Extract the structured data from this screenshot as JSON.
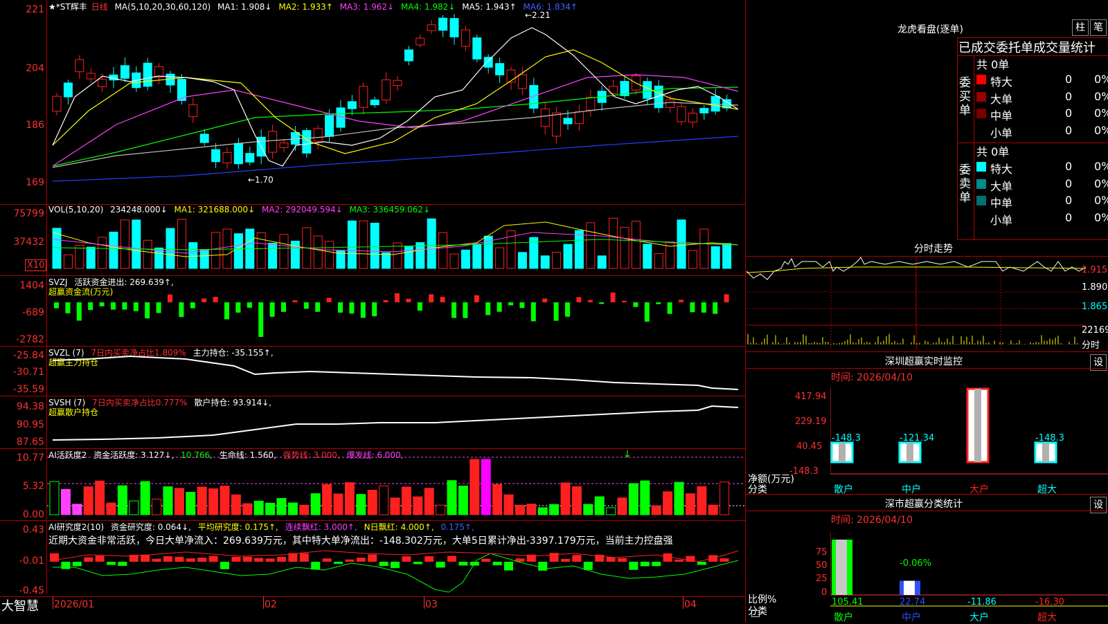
{
  "main": {
    "title_prefix": "★*ST辉丰",
    "period": "日线",
    "ma_label": "MA(5,10,20,30,60,120)",
    "ma1": "MA1: 1.908↓",
    "ma2": "MA2: 1.933↑",
    "ma3": "MA3: 1.962↓",
    "ma4": "MA4: 1.982↓",
    "ma5": "MA5: 1.943↑",
    "ma6": "MA6: 1.834↑",
    "high_mark": "2.21",
    "low_mark": "1.70",
    "y_ticks": [
      "221",
      "204",
      "186",
      "169"
    ]
  },
  "vol": {
    "label": "VOL(5,10,20)",
    "value": "234248.000↓",
    "ma1": "MA1: 321688.000↓",
    "ma2": "MA2: 292049.594↓",
    "ma3": "MA3: 336459.062↓",
    "y_ticks": [
      "75799",
      "37432"
    ],
    "unit": "X10"
  },
  "svzj": {
    "label": "SVZJ",
    "line": "活跃资金进出: 269.639↑,",
    "sub": "超赢资金流(万元)",
    "y_ticks": [
      "1404",
      "-689",
      "-2782"
    ]
  },
  "svzl": {
    "label": "SVZL (7)",
    "ratio": "7日内买卖净占比1.809%",
    "hold": "主力持仓: -35.155↑,",
    "sub": "超赢主力持仓",
    "y_ticks": [
      "-25.84",
      "-30.71",
      "-35.59"
    ]
  },
  "svsh": {
    "label": "SVSH (7)",
    "ratio": "7日内买卖净占比0.777%",
    "hold": "散户持仓: 93.914↓,",
    "sub": "超赢散户持仓",
    "y_ticks": [
      "94.38",
      "90.95",
      "87.65"
    ]
  },
  "ai1": {
    "label": "AI活跃度2",
    "act": "资金活跃度: 3.127↓,",
    "v2": "10.766,",
    "life": "生命线: 1.560,",
    "strong": "强势线: 3.000,",
    "burst": "爆发线: 6.000,",
    "y_ticks": [
      "10.77",
      "5.32",
      "0.00"
    ]
  },
  "ai2": {
    "label": "AI研究度2(10)",
    "research": "资金研究度: 0.064↓,",
    "avg": "平均研究度: 0.175↑,",
    "cont": "连续飘红: 3.000↑,",
    "nday": "N日飘红: 4.000↑,",
    "tail": "0.175↑,",
    "summary": "近期大资金非常活跃，今日大单净流入：269.639万元，其中特大单净流出：-148.302万元，大单5日累计净出-3397.179万元，当前主力控盘强",
    "y_ticks": [
      "0.43",
      "-0.01",
      "-0.45"
    ]
  },
  "xaxis": {
    "brand": "大智慧",
    "labels": [
      "2026/01",
      "02",
      "03",
      "04"
    ]
  },
  "lhkp": {
    "title": "龙虎看盘(逐单)",
    "btn_bar": "柱",
    "btn_pen": "笔",
    "section_title": "已成交委托单成交量统计",
    "buy_side": "委买单",
    "sell_side": "委卖单",
    "buy_total": "共 0单",
    "sell_total": "共 0单",
    "buy_rows": [
      {
        "name": "特大",
        "count": "0",
        "pct": "0%",
        "color": "#ff0000"
      },
      {
        "name": "大单",
        "count": "0",
        "pct": "0%",
        "color": "#990000"
      },
      {
        "name": "中单",
        "count": "0",
        "pct": "0%",
        "color": "#770000"
      },
      {
        "name": "小单",
        "count": "0",
        "pct": "0%",
        "color": "#000000"
      }
    ],
    "sell_rows": [
      {
        "name": "特大",
        "count": "0",
        "pct": "0%",
        "color": "#00ffff"
      },
      {
        "name": "大单",
        "count": "0",
        "pct": "0%",
        "color": "#008c8c"
      },
      {
        "name": "中单",
        "count": "0",
        "pct": "0%",
        "color": "#007070"
      },
      {
        "name": "小单",
        "count": "0",
        "pct": "0%",
        "color": "#000000"
      }
    ]
  },
  "fszs": {
    "title": "分时走势",
    "y_ticks": [
      "1.915",
      "1.890",
      "1.865"
    ],
    "vol_label": "22169",
    "bottom_label": "分时"
  },
  "szjk": {
    "title": "深圳超赢实时监控",
    "btn": "设",
    "time": "时间: 2026/04/10",
    "y_ticks": [
      "417.94",
      "229.19",
      "40.45",
      "-148.3"
    ],
    "ylabel": "净额(万元)",
    "xlabel": "分类",
    "categories": [
      "散户",
      "中户",
      "大户",
      "超大"
    ],
    "values": [
      -148.3,
      -121.34,
      417.94,
      -148.3
    ],
    "value_labels": [
      "-148.3",
      "-121.34",
      "417.94",
      "-148.3"
    ]
  },
  "sfl": {
    "title": "深市超赢分类统计",
    "btn": "设",
    "time": "时间: 2026/04/10",
    "y_ticks": [
      "75",
      "50",
      "25",
      "0"
    ],
    "ylabel": "比例%",
    "xlabel": "分类",
    "categories": [
      "散户",
      "中户",
      "大户",
      "超大"
    ],
    "values": [
      105.41,
      22.74,
      -11.86,
      -16.3
    ],
    "value_labels": [
      "105.41",
      "22.74",
      "-11.86",
      "-16.30"
    ],
    "bar_top_label": "-0.06%"
  },
  "colors": {
    "up": "#ff2020",
    "down": "#00ffff",
    "grid": "#b00000",
    "ma1": "#ffffff",
    "ma2": "#ffff00",
    "ma3": "#ff40ff",
    "ma4": "#00ff00",
    "ma5": "#c0c0c0",
    "ma6": "#2040ff"
  }
}
